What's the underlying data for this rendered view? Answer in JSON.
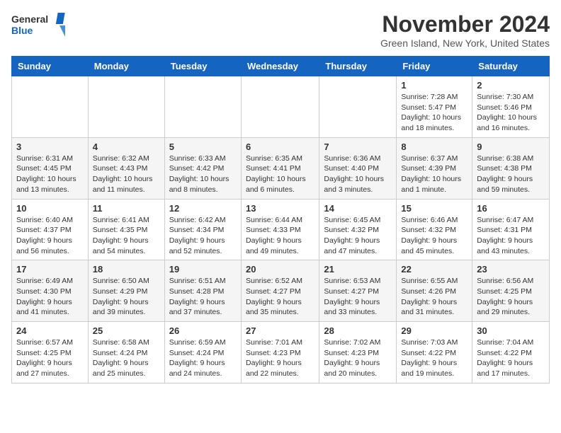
{
  "logo": {
    "line1": "General",
    "line2": "Blue"
  },
  "title": "November 2024",
  "location": "Green Island, New York, United States",
  "weekdays": [
    "Sunday",
    "Monday",
    "Tuesday",
    "Wednesday",
    "Thursday",
    "Friday",
    "Saturday"
  ],
  "weeks": [
    [
      {
        "day": "",
        "info": ""
      },
      {
        "day": "",
        "info": ""
      },
      {
        "day": "",
        "info": ""
      },
      {
        "day": "",
        "info": ""
      },
      {
        "day": "",
        "info": ""
      },
      {
        "day": "1",
        "info": "Sunrise: 7:28 AM\nSunset: 5:47 PM\nDaylight: 10 hours and 18 minutes."
      },
      {
        "day": "2",
        "info": "Sunrise: 7:30 AM\nSunset: 5:46 PM\nDaylight: 10 hours and 16 minutes."
      }
    ],
    [
      {
        "day": "3",
        "info": "Sunrise: 6:31 AM\nSunset: 4:45 PM\nDaylight: 10 hours and 13 minutes."
      },
      {
        "day": "4",
        "info": "Sunrise: 6:32 AM\nSunset: 4:43 PM\nDaylight: 10 hours and 11 minutes."
      },
      {
        "day": "5",
        "info": "Sunrise: 6:33 AM\nSunset: 4:42 PM\nDaylight: 10 hours and 8 minutes."
      },
      {
        "day": "6",
        "info": "Sunrise: 6:35 AM\nSunset: 4:41 PM\nDaylight: 10 hours and 6 minutes."
      },
      {
        "day": "7",
        "info": "Sunrise: 6:36 AM\nSunset: 4:40 PM\nDaylight: 10 hours and 3 minutes."
      },
      {
        "day": "8",
        "info": "Sunrise: 6:37 AM\nSunset: 4:39 PM\nDaylight: 10 hours and 1 minute."
      },
      {
        "day": "9",
        "info": "Sunrise: 6:38 AM\nSunset: 4:38 PM\nDaylight: 9 hours and 59 minutes."
      }
    ],
    [
      {
        "day": "10",
        "info": "Sunrise: 6:40 AM\nSunset: 4:37 PM\nDaylight: 9 hours and 56 minutes."
      },
      {
        "day": "11",
        "info": "Sunrise: 6:41 AM\nSunset: 4:35 PM\nDaylight: 9 hours and 54 minutes."
      },
      {
        "day": "12",
        "info": "Sunrise: 6:42 AM\nSunset: 4:34 PM\nDaylight: 9 hours and 52 minutes."
      },
      {
        "day": "13",
        "info": "Sunrise: 6:44 AM\nSunset: 4:33 PM\nDaylight: 9 hours and 49 minutes."
      },
      {
        "day": "14",
        "info": "Sunrise: 6:45 AM\nSunset: 4:32 PM\nDaylight: 9 hours and 47 minutes."
      },
      {
        "day": "15",
        "info": "Sunrise: 6:46 AM\nSunset: 4:32 PM\nDaylight: 9 hours and 45 minutes."
      },
      {
        "day": "16",
        "info": "Sunrise: 6:47 AM\nSunset: 4:31 PM\nDaylight: 9 hours and 43 minutes."
      }
    ],
    [
      {
        "day": "17",
        "info": "Sunrise: 6:49 AM\nSunset: 4:30 PM\nDaylight: 9 hours and 41 minutes."
      },
      {
        "day": "18",
        "info": "Sunrise: 6:50 AM\nSunset: 4:29 PM\nDaylight: 9 hours and 39 minutes."
      },
      {
        "day": "19",
        "info": "Sunrise: 6:51 AM\nSunset: 4:28 PM\nDaylight: 9 hours and 37 minutes."
      },
      {
        "day": "20",
        "info": "Sunrise: 6:52 AM\nSunset: 4:27 PM\nDaylight: 9 hours and 35 minutes."
      },
      {
        "day": "21",
        "info": "Sunrise: 6:53 AM\nSunset: 4:27 PM\nDaylight: 9 hours and 33 minutes."
      },
      {
        "day": "22",
        "info": "Sunrise: 6:55 AM\nSunset: 4:26 PM\nDaylight: 9 hours and 31 minutes."
      },
      {
        "day": "23",
        "info": "Sunrise: 6:56 AM\nSunset: 4:25 PM\nDaylight: 9 hours and 29 minutes."
      }
    ],
    [
      {
        "day": "24",
        "info": "Sunrise: 6:57 AM\nSunset: 4:25 PM\nDaylight: 9 hours and 27 minutes."
      },
      {
        "day": "25",
        "info": "Sunrise: 6:58 AM\nSunset: 4:24 PM\nDaylight: 9 hours and 25 minutes."
      },
      {
        "day": "26",
        "info": "Sunrise: 6:59 AM\nSunset: 4:24 PM\nDaylight: 9 hours and 24 minutes."
      },
      {
        "day": "27",
        "info": "Sunrise: 7:01 AM\nSunset: 4:23 PM\nDaylight: 9 hours and 22 minutes."
      },
      {
        "day": "28",
        "info": "Sunrise: 7:02 AM\nSunset: 4:23 PM\nDaylight: 9 hours and 20 minutes."
      },
      {
        "day": "29",
        "info": "Sunrise: 7:03 AM\nSunset: 4:22 PM\nDaylight: 9 hours and 19 minutes."
      },
      {
        "day": "30",
        "info": "Sunrise: 7:04 AM\nSunset: 4:22 PM\nDaylight: 9 hours and 17 minutes."
      }
    ]
  ]
}
